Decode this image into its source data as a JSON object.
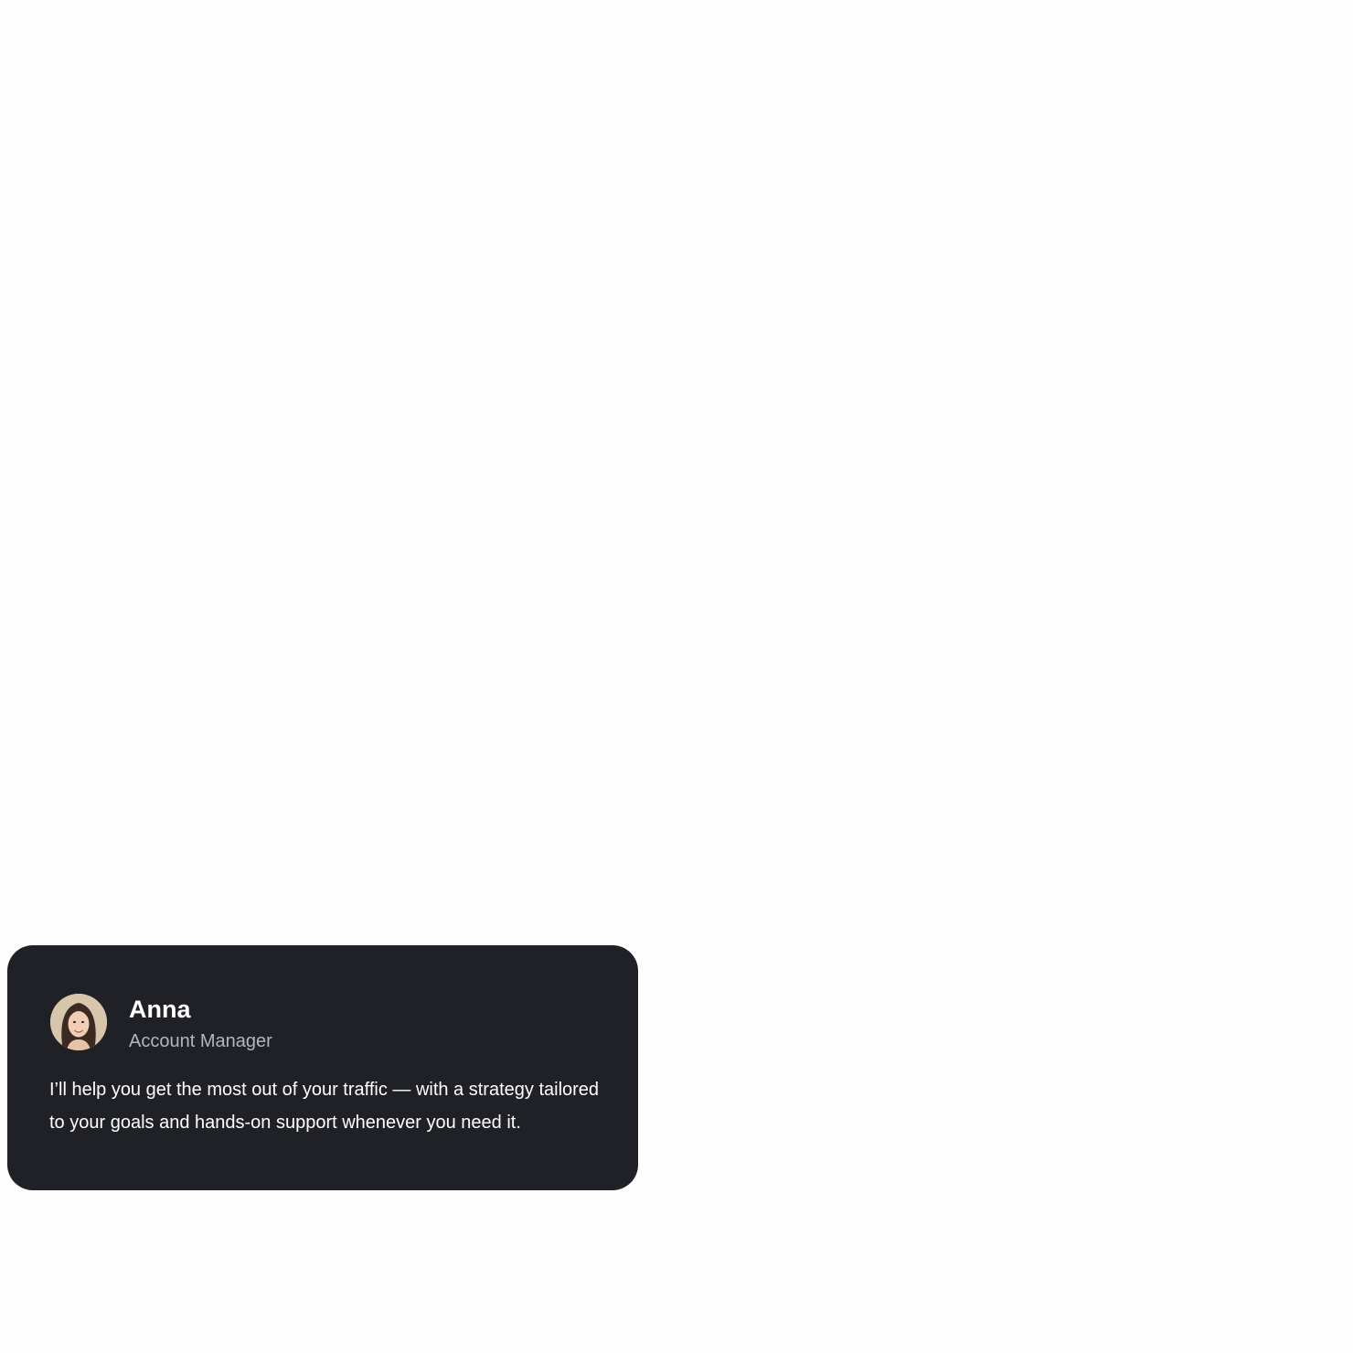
{
  "manager_card": {
    "avatar_icon": "person-avatar-photo",
    "name": "Anna",
    "role": "Account Manager",
    "message": "I’ll help you get the most out of your traffic — with a strategy tailored to your goals and hands-on support whenever you need it."
  },
  "colors": {
    "page_background": "#fefefe",
    "card_background": "#1f2126",
    "name_text": "#ffffff",
    "role_text": "#b3b6bc",
    "message_text": "#ffffff"
  }
}
